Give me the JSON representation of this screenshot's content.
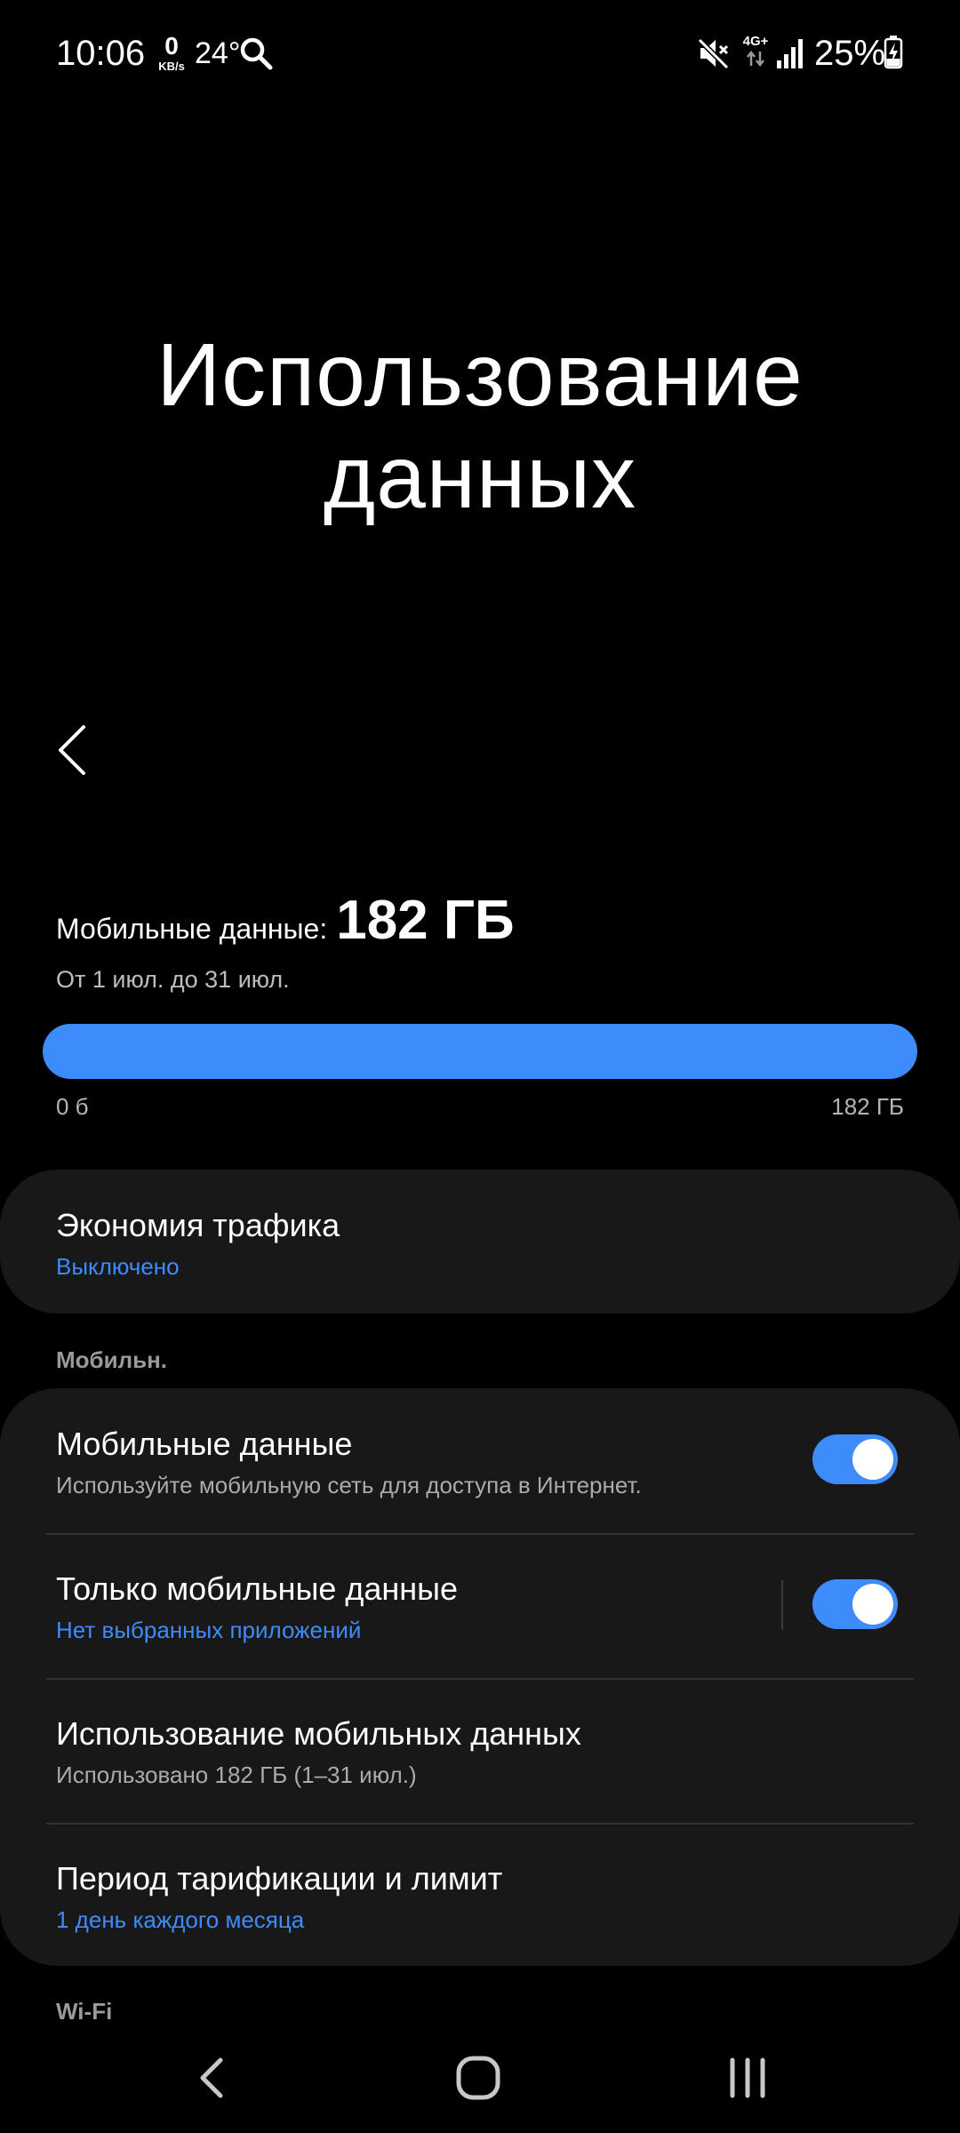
{
  "status_bar": {
    "time": "10:06",
    "net_speed_value": "0",
    "net_speed_unit": "KB/s",
    "temperature": "24°",
    "network_type": "4G+",
    "battery_percent": "25%"
  },
  "page": {
    "title": "Использование данных"
  },
  "usage": {
    "label": "Мобильные данные:",
    "value": "182 ГБ",
    "period": "От 1 июл. до 31 июл.",
    "bar_min": "0 б",
    "bar_max": "182 ГБ",
    "bar_fraction": 1.0
  },
  "data_saver": {
    "title": "Экономия трафика",
    "status": "Выключено"
  },
  "section_mobile": {
    "label": "Мобильн.",
    "items": [
      {
        "title": "Мобильные данные",
        "subtitle": "Используйте мобильную сеть для доступа в Интернет.",
        "toggle_on": true
      },
      {
        "title": "Только мобильные данные",
        "subtitle": "Нет выбранных приложений",
        "toggle_on": true
      },
      {
        "title": "Использование мобильных данных",
        "subtitle": "Использовано 182 ГБ (1–31 июл.)"
      },
      {
        "title": "Период тарификации и лимит",
        "subtitle": "1 день каждого месяца"
      }
    ]
  },
  "section_wifi": {
    "label": "Wi-Fi"
  },
  "colors": {
    "accent": "#3e8bfb",
    "card_bg": "#181818",
    "background": "#000000"
  }
}
